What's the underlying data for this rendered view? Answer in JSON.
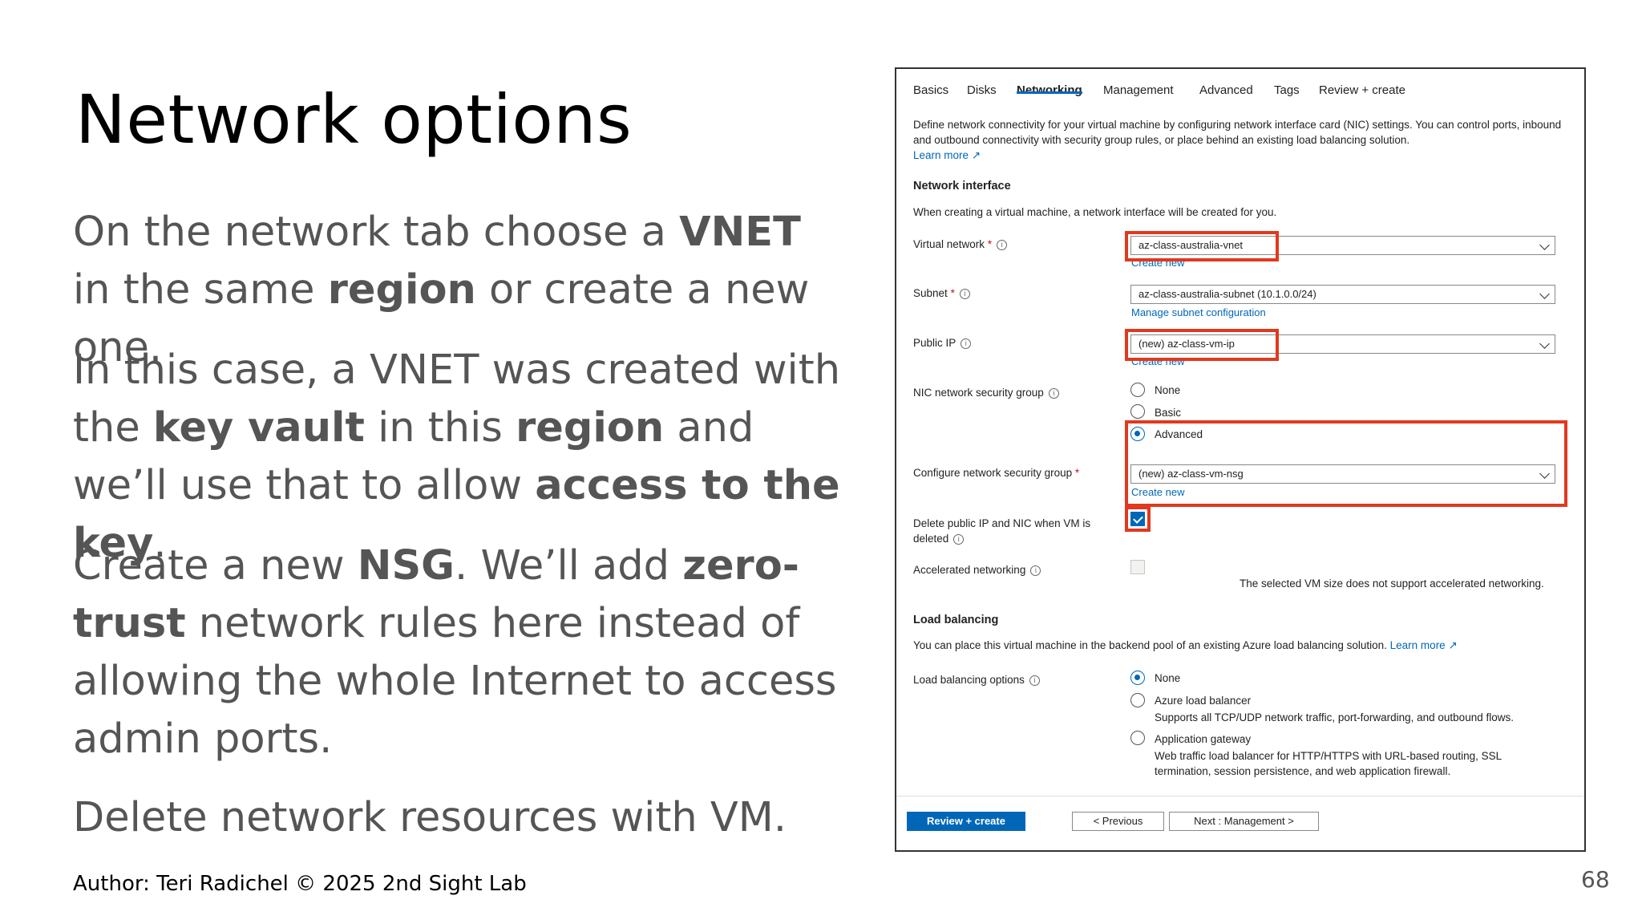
{
  "slide": {
    "title": "Network options",
    "p1": [
      "On the network tab choose a ",
      "VNET",
      " in the same ",
      "region",
      " or create a new one."
    ],
    "p2": [
      "In this case, a VNET was created with the ",
      "key vault",
      " in this ",
      "region",
      " and we’ll use that to allow ",
      "access to the key",
      "."
    ],
    "p3": [
      "Create a new ",
      "NSG",
      ". We’ll add ",
      "zero-trust",
      " network rules here instead of allowing the whole Internet to access admin ports."
    ],
    "p4": "Delete network resources with VM.",
    "footer": "Author: Teri Radichel © 2025 2nd Sight Lab",
    "page_number": "68"
  },
  "screenshot": {
    "tabs": [
      "Basics",
      "Disks",
      "Networking",
      "Management",
      "Advanced",
      "Tags",
      "Review + create"
    ],
    "active_tab": "Networking",
    "intro": "Define network connectivity for your virtual machine by configuring network interface card (NIC) settings. You can control ports, inbound and outbound connectivity with security group rules, or place behind an existing load balancing solution.",
    "learn_more": "Learn more",
    "network_interface": {
      "heading": "Network interface",
      "description": "When creating a virtual machine, a network interface will be created for you.",
      "virtual_network_label": "Virtual network",
      "virtual_network_value": "az-class-australia-vnet",
      "create_new": "Create new",
      "subnet_label": "Subnet",
      "subnet_value": "az-class-australia-subnet (10.1.0.0/24)",
      "manage_subnet": "Manage subnet configuration",
      "public_ip_label": "Public IP",
      "public_ip_value": "(new) az-class-vm-ip",
      "nsg_label": "NIC network security group",
      "nsg_options": [
        "None",
        "Basic",
        "Advanced"
      ],
      "nsg_selected": "Advanced",
      "configure_nsg_label": "Configure network security group",
      "configure_nsg_value": "(new) az-class-vm-nsg",
      "delete_label": "Delete public IP and NIC when VM is deleted",
      "delete_checked": true,
      "accel_label": "Accelerated networking",
      "accel_note": "The selected VM size does not support accelerated networking."
    },
    "load_balancing": {
      "heading": "Load balancing",
      "description": "You can place this virtual machine in the backend pool of an existing Azure load balancing solution.",
      "learn_more": "Learn more",
      "options_label": "Load balancing options",
      "none": "None",
      "alb": "Azure load balancer",
      "alb_desc": "Supports all TCP/UDP network traffic, port-forwarding, and outbound flows.",
      "agw": "Application gateway",
      "agw_desc1": "Web traffic load balancer for HTTP/HTTPS with URL-based routing, SSL",
      "agw_desc2": "termination, session persistence, and web application firewall."
    },
    "buttons": {
      "review": "Review + create",
      "previous": "< Previous",
      "next": "Next : Management >"
    },
    "icons": {
      "info": "info-circle-icon",
      "external": "external-link-icon",
      "chevron": "chevron-down-icon"
    },
    "colors": {
      "accent": "#0067b8",
      "highlight": "#e0391f",
      "text": "#555555"
    }
  }
}
